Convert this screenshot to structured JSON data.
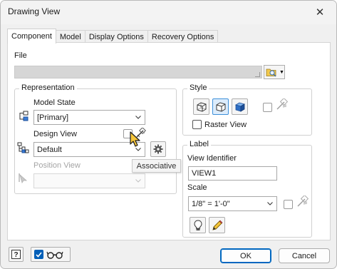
{
  "window": {
    "title": "Drawing View",
    "close_glyph": "✕"
  },
  "tabs": [
    {
      "label": "Component",
      "active": true
    },
    {
      "label": "Model",
      "active": false
    },
    {
      "label": "Display Options",
      "active": false
    },
    {
      "label": "Recovery Options",
      "active": false
    }
  ],
  "file": {
    "label": "File",
    "value": ""
  },
  "representation": {
    "title": "Representation",
    "model_state": {
      "label": "Model State",
      "value": "[Primary]"
    },
    "design_view": {
      "label": "Design View",
      "value": "Default",
      "associative_checked": false
    },
    "position_view": {
      "label": "Position View",
      "value": "",
      "enabled": false
    }
  },
  "tooltip": {
    "text": "Associative"
  },
  "style": {
    "title": "Style",
    "selected_style_index": 1,
    "raster_view": {
      "label": "Raster View",
      "checked": false
    },
    "style_from_base_checked": false
  },
  "label_group": {
    "title": "Label",
    "view_identifier": {
      "label": "View Identifier",
      "value": "VIEW1"
    },
    "scale": {
      "label": "Scale",
      "value": "1/8\" = 1'-0\""
    },
    "scale_from_base_checked": false
  },
  "footer": {
    "help_icon": "help-icon",
    "preview_checked": true,
    "ok_label": "OK",
    "cancel_label": "Cancel"
  },
  "colors": {
    "accent": "#005fb8",
    "selected_button": "#dcecfc",
    "cursor": "#f5c53a"
  }
}
